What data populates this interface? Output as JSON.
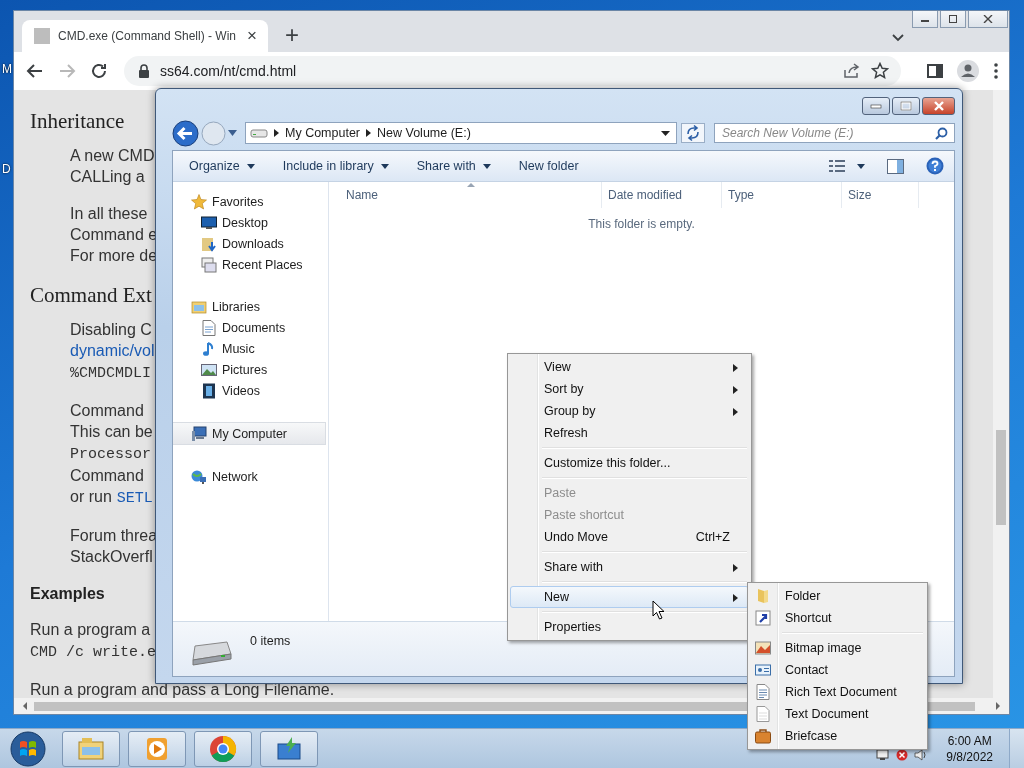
{
  "desktop": {
    "icon_labels": [
      "M",
      "D"
    ]
  },
  "browser": {
    "tab": {
      "title": "CMD.exe (Command Shell) - Win",
      "close": "×"
    },
    "new_tab": "+",
    "address": "ss64.com/nt/cmd.html"
  },
  "page": {
    "blocks": [
      {
        "kind": "heading",
        "lines": [
          [
            {
              "kind": "plain",
              "text": "Inheritance"
            }
          ]
        ]
      },
      {
        "kind": "para",
        "lines": [
          [
            {
              "kind": "plain",
              "text": "A new CMD"
            }
          ],
          [
            {
              "kind": "plain",
              "text": "CALLing a"
            }
          ]
        ]
      },
      {
        "kind": "para",
        "lines": [
          [
            {
              "kind": "plain",
              "text": "In all these"
            }
          ],
          [
            {
              "kind": "plain",
              "text": "Command e"
            }
          ],
          [
            {
              "kind": "plain",
              "text": "For more de"
            }
          ]
        ]
      },
      {
        "kind": "heading",
        "lines": [
          [
            {
              "kind": "plain",
              "text": "Command Ext"
            }
          ]
        ]
      },
      {
        "kind": "para",
        "lines": [
          [
            {
              "kind": "plain",
              "text": "Disabling C"
            }
          ],
          [
            {
              "kind": "link",
              "text": "dynamic/vol"
            }
          ],
          [
            {
              "kind": "code",
              "text": "%CMDCMDLI"
            }
          ]
        ]
      },
      {
        "kind": "para",
        "lines": [
          [
            {
              "kind": "plain",
              "text": "Command"
            }
          ],
          [
            {
              "kind": "plain",
              "text": "This can be"
            }
          ],
          [
            {
              "kind": "code",
              "text": "Processor"
            }
          ],
          [
            {
              "kind": "plain",
              "text": "Command"
            }
          ],
          [
            {
              "kind": "plain",
              "text": "or run"
            },
            {
              "kind": "codelink",
              "text": "SETL"
            }
          ]
        ]
      },
      {
        "kind": "para",
        "lines": [
          [
            {
              "kind": "plain",
              "text": "Forum threa"
            }
          ],
          [
            {
              "kind": "plain",
              "text": "StackOverfl"
            }
          ]
        ]
      },
      {
        "kind": "subheading",
        "lines": [
          [
            {
              "kind": "plain",
              "text": "Examples"
            }
          ]
        ]
      },
      {
        "kind": "flush",
        "lines": [
          [
            {
              "kind": "plain",
              "text": "Run a program a"
            }
          ],
          [
            {
              "kind": "code",
              "text": "CMD /c write.e"
            }
          ]
        ]
      }
    ],
    "last_line": "Run a program and pass a Long Filename."
  },
  "explorer": {
    "breadcrumb": [
      "My Computer",
      "New Volume (E:)"
    ],
    "search": {
      "placeholder": "Search New Volume (E:)"
    },
    "toolbar": [
      {
        "label": "Organize",
        "dropdown": true
      },
      {
        "label": "Include in library",
        "dropdown": true
      },
      {
        "label": "Share with",
        "dropdown": true
      },
      {
        "label": "New folder",
        "dropdown": false
      }
    ],
    "nav": [
      {
        "kind": "star",
        "label": "Favorites",
        "selected": false,
        "children": [
          {
            "kind": "desktop",
            "label": "Desktop",
            "selected": false
          },
          {
            "kind": "downloads",
            "label": "Downloads",
            "selected": false
          },
          {
            "kind": "recent",
            "label": "Recent Places",
            "selected": false
          }
        ]
      },
      {
        "kind": "libraries",
        "label": "Libraries",
        "selected": false,
        "children": [
          {
            "kind": "document",
            "label": "Documents",
            "selected": false
          },
          {
            "kind": "music",
            "label": "Music",
            "selected": false
          },
          {
            "kind": "pictures",
            "label": "Pictures",
            "selected": false
          },
          {
            "kind": "videos",
            "label": "Videos",
            "selected": false
          }
        ]
      },
      {
        "kind": "computer",
        "label": "My Computer",
        "selected": true
      },
      {
        "kind": "network",
        "label": "Network",
        "selected": false
      }
    ],
    "columns": [
      "Name",
      "Date modified",
      "Type",
      "Size"
    ],
    "empty_message": "This folder is empty.",
    "status": "0 items"
  },
  "context_menu": {
    "items": [
      {
        "kind": "item",
        "label": "View",
        "submenu": true,
        "disabled": false,
        "selected": false
      },
      {
        "kind": "item",
        "label": "Sort by",
        "submenu": true,
        "disabled": false,
        "selected": false
      },
      {
        "kind": "item",
        "label": "Group by",
        "submenu": true,
        "disabled": false,
        "selected": false
      },
      {
        "kind": "item",
        "label": "Refresh",
        "submenu": false,
        "disabled": false,
        "selected": false
      },
      {
        "kind": "separator"
      },
      {
        "kind": "item",
        "label": "Customize this folder...",
        "submenu": false,
        "disabled": false,
        "selected": false
      },
      {
        "kind": "separator"
      },
      {
        "kind": "item",
        "label": "Paste",
        "submenu": false,
        "disabled": true,
        "selected": false
      },
      {
        "kind": "item",
        "label": "Paste shortcut",
        "submenu": false,
        "disabled": true,
        "selected": false
      },
      {
        "kind": "item",
        "label": "Undo Move",
        "accelerator": "Ctrl+Z",
        "submenu": false,
        "disabled": false,
        "selected": false
      },
      {
        "kind": "separator"
      },
      {
        "kind": "item",
        "label": "Share with",
        "submenu": true,
        "disabled": false,
        "selected": false
      },
      {
        "kind": "separator"
      },
      {
        "kind": "item",
        "label": "New",
        "submenu": true,
        "disabled": false,
        "selected": true
      },
      {
        "kind": "separator"
      },
      {
        "kind": "item",
        "label": "Properties",
        "submenu": false,
        "disabled": false,
        "selected": false
      }
    ]
  },
  "new_submenu": {
    "items": [
      {
        "kind": "folder",
        "label": "Folder"
      },
      {
        "kind": "shortcut",
        "label": "Shortcut"
      },
      {
        "kind": "separator"
      },
      {
        "kind": "bitmap",
        "label": "Bitmap image"
      },
      {
        "kind": "contact",
        "label": "Contact"
      },
      {
        "kind": "richtext",
        "label": "Rich Text Document"
      },
      {
        "kind": "text",
        "label": "Text Document"
      },
      {
        "kind": "briefcase",
        "label": "Briefcase"
      }
    ]
  },
  "taskbar": {
    "apps": [
      {
        "kind": "explorer"
      },
      {
        "kind": "media"
      },
      {
        "kind": "chrome"
      },
      {
        "kind": "installer"
      }
    ],
    "clock": {
      "time": "6:00 AM",
      "date": "9/8/2022"
    }
  }
}
